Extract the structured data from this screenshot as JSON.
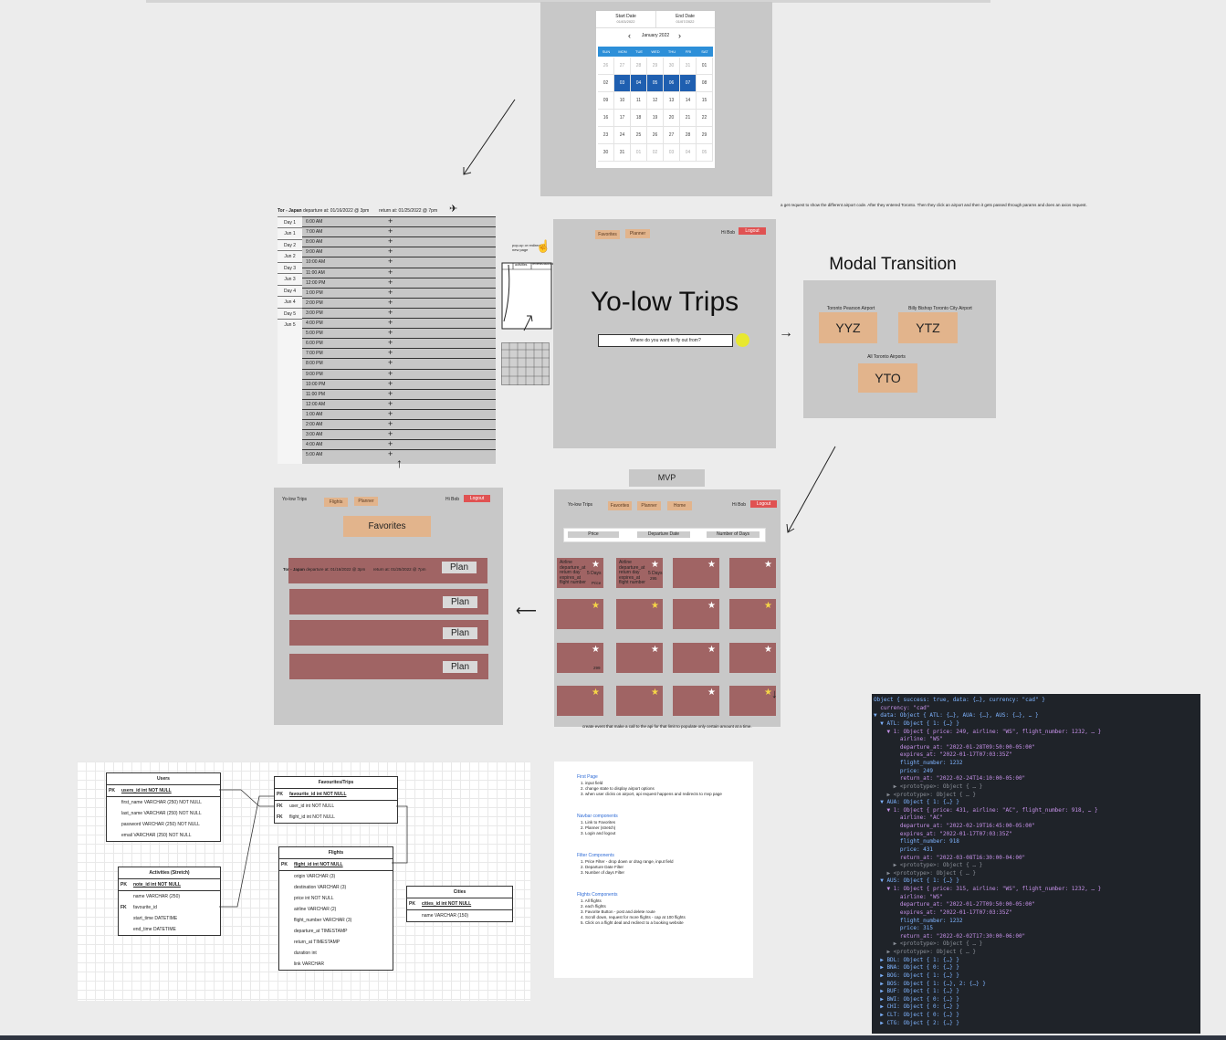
{
  "calendar": {
    "start_label": "Start Date",
    "start_value": "01/03/2022",
    "end_label": "End Date",
    "end_value": "01/07/2022",
    "month": "January 2022",
    "weekdays": [
      "SUN",
      "MON",
      "TUE",
      "WED",
      "THU",
      "FRI",
      "SAT"
    ],
    "weeks": [
      [
        "26",
        "27",
        "28",
        "29",
        "30",
        "31",
        "01"
      ],
      [
        "02",
        "03",
        "04",
        "05",
        "06",
        "07",
        "08"
      ],
      [
        "09",
        "10",
        "11",
        "12",
        "13",
        "14",
        "15"
      ],
      [
        "16",
        "17",
        "18",
        "19",
        "20",
        "21",
        "22"
      ],
      [
        "23",
        "24",
        "25",
        "26",
        "27",
        "28",
        "29"
      ],
      [
        "30",
        "31",
        "01",
        "02",
        "03",
        "04",
        "05"
      ]
    ],
    "selected": [
      "03",
      "04",
      "05",
      "06",
      "07"
    ],
    "accent": "#1f5fb0",
    "header_color": "#2d8fd8"
  },
  "note_airport": "a get request to show the different airport code. After they entered Toronto. Then they click an airport and then it gets passed through params and does an axios request.",
  "schedule": {
    "header_from": "Tor - Japan",
    "header_departure": "departure at: 01/16/2022 @ 3pm",
    "header_return": "return at: 01/25/2022 @ 7pm",
    "days": [
      "Day 1",
      "Jun 1",
      "Day 2",
      "Jun 2",
      "Day 3",
      "Jun 3",
      "Day 4",
      "Jun 4",
      "Day 5",
      "Jun 5"
    ],
    "times": [
      "6:00 AM",
      "7:00 AM",
      "8:00 AM",
      "9:00 AM",
      "10:00 AM",
      "11:00 AM",
      "12:00 PM",
      "1:00 PM",
      "2:00 PM",
      "3:00 PM",
      "4:00 PM",
      "5:00 PM",
      "6:00 PM",
      "7:00 PM",
      "8:00 PM",
      "9:00 PM",
      "10:00 PM",
      "11:00 PM",
      "12:00 AM",
      "1:00 AM",
      "2:00 AM",
      "3:00 AM",
      "4:00 AM",
      "5:00 AM"
    ],
    "sketch_note": "pop-up or redirect new page",
    "sketch_headers": [
      "activities",
      "reviews/activities"
    ]
  },
  "home": {
    "nav_favorites": "Favorites",
    "nav_planner": "Planner",
    "greeting": "Hi Bob",
    "logout": "Logout",
    "title": "Yo-low Trips",
    "search_placeholder": "Where do you want to fly out from?"
  },
  "modal": {
    "heading": "Modal Transition",
    "airports": [
      {
        "name": "Toronto Pearson Airport",
        "code": "YYZ"
      },
      {
        "name": "Billy Bishop Toronto City Airport",
        "code": "YTZ"
      },
      {
        "name": "All Toronto Airports",
        "code": "YTO"
      }
    ]
  },
  "favorites_page": {
    "brand": "Yo-low Trips",
    "nav_flights": "Flights",
    "nav_planner": "Planner",
    "greeting": "Hi Bob",
    "logout": "Logout",
    "title": "Favorites",
    "trip_from": "Tor - Japan",
    "trip_departure": "departure at: 01/16/2022 @ 3pm",
    "trip_return": "return at: 01/25/2022 @ 7pm",
    "plan_label": "Plan"
  },
  "mvp": {
    "label": "MVP",
    "brand": "Yo-low Trips",
    "nav_favorites": "Favorites",
    "nav_planner": "Planner",
    "nav_home": "Home",
    "greeting": "Hi Bob",
    "logout": "Logout",
    "filter_price": "Price",
    "filter_departure": "Departure Date",
    "filter_days": "Number of Days",
    "card1_text": "Airline\ndeparture_at\nreturn day\nexpires_at\nflight number",
    "card1_days": "5 Days",
    "card1_price": "Price",
    "card2_text": "Airline\ndeparture_at\nreturn day\nexpires_at\nflight number",
    "card2_days": "5 Days",
    "card2_price": "295",
    "card_small_price": "299",
    "footer_note": "create event that make a call to the api for that limit to populate only certain amount at a time."
  },
  "erd": {
    "users": {
      "title": "Users",
      "rows": [
        [
          "PK",
          "users_id int NOT NULL"
        ],
        [
          "",
          "first_name VARCHAR (250) NOT NULL"
        ],
        [
          "",
          "last_name VARCHAR (250) NOT NULL"
        ],
        [
          "",
          "password VARCHAR (250) NOT NULL"
        ],
        [
          "",
          "email VARCHAR (250) NOT NULL"
        ]
      ]
    },
    "favourites": {
      "title": "Favourites/Trips",
      "rows": [
        [
          "PK",
          "favourite_id int NOT NULL"
        ],
        [
          "FK",
          "user_id int NOT NULL"
        ],
        [
          "FK",
          "flight_id int NOT NULL"
        ]
      ]
    },
    "activities": {
      "title": "Activities (Stretch)",
      "rows": [
        [
          "PK",
          "note_id int NOT NULL"
        ],
        [
          "",
          "name VARCHAR (250)"
        ],
        [
          "FK",
          "favourite_id"
        ],
        [
          "",
          "start_time DATETIME"
        ],
        [
          "",
          "end_time DATETIME"
        ]
      ]
    },
    "flights": {
      "title": "Flights",
      "rows": [
        [
          "PK",
          "flight_id int NOT NULL"
        ],
        [
          "",
          "origin VARCHAR (3)"
        ],
        [
          "",
          "destination VARCHAR (3)"
        ],
        [
          "",
          "price int NOT NULL"
        ],
        [
          "",
          "airline VARCHAR (2)"
        ],
        [
          "",
          "flight_number VARCHAR (3)"
        ],
        [
          "",
          "departure_at TIMESTAMP"
        ],
        [
          "",
          "return_at TIMESTAMP"
        ],
        [
          "",
          "duration int"
        ],
        [
          "",
          "link VARCHAR"
        ]
      ]
    },
    "cities": {
      "title": "Cities",
      "rows": [
        [
          "PK",
          "cities_id int NOT NULL"
        ],
        [
          "",
          "name VARCHAR (150)"
        ]
      ]
    }
  },
  "notes": {
    "sections": [
      {
        "heading": "First Page",
        "lines": [
          "1. input field",
          "2. change state to display airport options",
          "3. when user clicks on airport, api request happens and redirects to mvp page"
        ]
      },
      {
        "heading": "Navbar components",
        "lines": [
          "1. Link to Favorites",
          "2. Planner (stretch)",
          "3. Login and logout"
        ]
      },
      {
        "heading": "Filter Components",
        "lines": [
          "1. Price Filter - drop down or drag range, input field",
          "2. Departure Date Filter",
          "3. Number of days Filter"
        ]
      },
      {
        "heading": "Flights Components",
        "lines": [
          "1. All flights",
          "2. each flights",
          "3. Favorite Button - post and delete route",
          "4. Scroll down, request for more flights - cap at 100 flights",
          "5. Click on a flight deal and redirect to a booking website"
        ]
      }
    ]
  },
  "console": {
    "lines": [
      "Object { success: true, data: {…}, currency: \"cad\" }",
      "  currency: \"cad\"",
      "▼ data: Object { ATL: {…}, AUA: {…}, AUS: {…}, … }",
      "  ▼ ATL: Object { 1: {…} }",
      "    ▼ 1: Object { price: 249, airline: \"WS\", flight_number: 1232, … }",
      "        airline: \"WS\"",
      "        departure_at: \"2022-01-28T09:50:00-05:00\"",
      "        expires_at: \"2022-01-17T07:03:35Z\"",
      "        flight_number: 1232",
      "        price: 249",
      "        return_at: \"2022-02-24T14:10:00-05:00\"",
      "      ▶ <prototype>: Object { … }",
      "    ▶ <prototype>: Object { … }",
      "  ▼ AUA: Object { 1: {…} }",
      "    ▼ 1: Object { price: 431, airline: \"AC\", flight_number: 918, … }",
      "        airline: \"AC\"",
      "        departure_at: \"2022-02-19T16:45:00-05:00\"",
      "        expires_at: \"2022-01-17T07:03:35Z\"",
      "        flight_number: 918",
      "        price: 431",
      "        return_at: \"2022-03-08T16:30:00-04:00\"",
      "      ▶ <prototype>: Object { … }",
      "    ▶ <prototype>: Object { … }",
      "  ▼ AUS: Object { 1: {…} }",
      "    ▼ 1: Object { price: 315, airline: \"WS\", flight_number: 1232, … }",
      "        airline: \"WS\"",
      "        departure_at: \"2022-01-27T09:50:00-05:00\"",
      "        expires_at: \"2022-01-17T07:03:35Z\"",
      "        flight_number: 1232",
      "        price: 315",
      "        return_at: \"2022-02-02T17:30:00-06:00\"",
      "      ▶ <prototype>: Object { … }",
      "    ▶ <prototype>: Object { … }",
      "  ▶ BDL: Object { 1: {…} }",
      "  ▶ BNA: Object { 0: {…} }",
      "  ▶ BOG: Object { 1: {…} }",
      "  ▶ BOS: Object { 1: {…}, 2: {…} }",
      "  ▶ BUF: Object { 1: {…} }",
      "  ▶ BWI: Object { 0: {…} }",
      "  ▶ CHI: Object { 0: {…} }",
      "  ▶ CLT: Object { 0: {…} }",
      "  ▶ CTG: Object { 2: {…} }"
    ],
    "bg": "#1f2329"
  }
}
